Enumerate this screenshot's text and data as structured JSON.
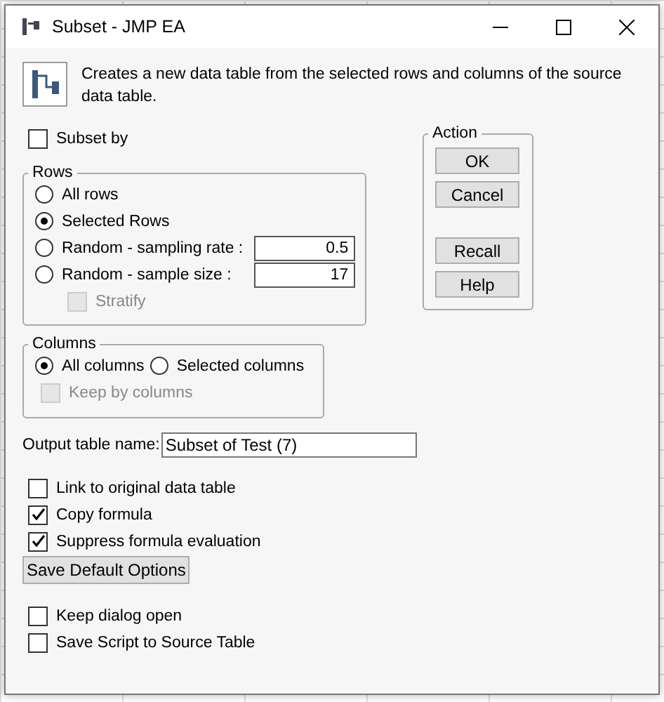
{
  "window": {
    "title": "Subset - JMP EA"
  },
  "description": "Creates a new data table from the selected rows and columns of the source data table.",
  "subset_by": {
    "label": "Subset by",
    "checked": false
  },
  "rows": {
    "title": "Rows",
    "options": [
      {
        "label": "All rows",
        "selected": false
      },
      {
        "label": "Selected Rows",
        "selected": true
      },
      {
        "label": "Random - sampling rate :",
        "selected": false,
        "value": "0.5"
      },
      {
        "label": "Random - sample size :",
        "selected": false,
        "value": "17"
      }
    ],
    "stratify": {
      "label": "Stratify",
      "checked": false,
      "disabled": true
    }
  },
  "columns": {
    "title": "Columns",
    "options": [
      {
        "label": "All columns",
        "selected": true
      },
      {
        "label": "Selected columns",
        "selected": false
      }
    ],
    "keep_by_columns": {
      "label": "Keep by columns",
      "checked": false,
      "disabled": true
    }
  },
  "action": {
    "title": "Action",
    "buttons": [
      "OK",
      "Cancel",
      "Recall",
      "Help"
    ]
  },
  "output_table_name": {
    "label": "Output table name:",
    "value": "Subset of Test (7)"
  },
  "options": [
    {
      "label": "Link to original data table",
      "checked": false
    },
    {
      "label": "Copy formula",
      "checked": true
    },
    {
      "label": "Suppress formula evaluation",
      "checked": true
    }
  ],
  "save_default_button": "Save Default Options",
  "dialog_options": [
    {
      "label": "Keep dialog open",
      "checked": false
    },
    {
      "label": "Save Script to Source Table",
      "checked": false
    }
  ]
}
